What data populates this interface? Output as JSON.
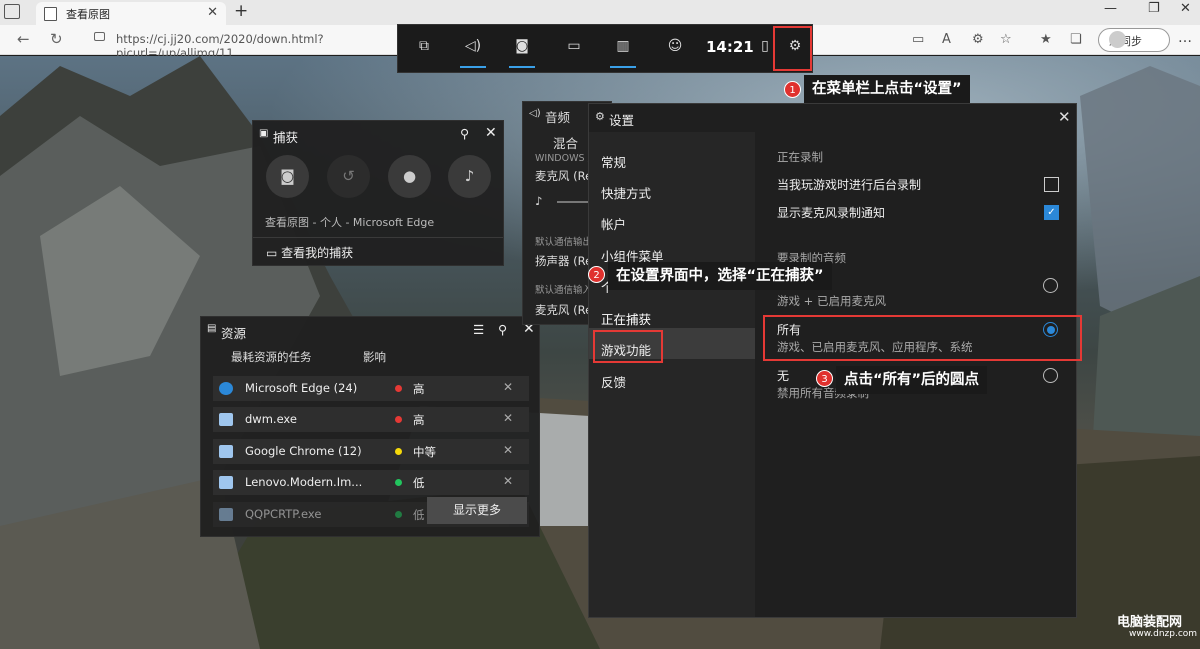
{
  "browser": {
    "tab_title": "查看原图",
    "url": "https://cj.jj20.com/2020/down.html?picurl=/up/allimg/11",
    "sync_label": "未同步"
  },
  "gamebar": {
    "time": "14:21"
  },
  "callouts": {
    "one": {
      "num": "1",
      "text": "在菜单栏上点击“设置”"
    },
    "two": {
      "num": "2",
      "text": "在设置界面中，选择“正在捕获”"
    },
    "three": {
      "num": "3",
      "text": "点击“所有”后的圆点"
    }
  },
  "capture": {
    "title": "捕获",
    "source": "查看原图 - 个人 - Microsoft Edge",
    "view_link": "查看我的捕获"
  },
  "resources": {
    "title": "资源",
    "col_task": "最耗资源的任务",
    "col_impact": "影响",
    "rows": [
      {
        "name": "Microsoft Edge (24)",
        "level": "高",
        "color": "#e53935"
      },
      {
        "name": "dwm.exe",
        "level": "高",
        "color": "#e53935"
      },
      {
        "name": "Google Chrome (12)",
        "level": "中等",
        "color": "#f5d90a"
      },
      {
        "name": "Lenovo.Modern.Im...",
        "level": "低",
        "color": "#22c55e"
      },
      {
        "name": "QQPCRTP.exe",
        "level": "低",
        "color": "#22c55e"
      }
    ],
    "show_more": "显示更多"
  },
  "audio": {
    "title": "音频",
    "tab_mix": "混合",
    "windows_label": "WINDOWS 默",
    "mic1": "麦克风 (Re",
    "default_out_label": "默认通信输出",
    "speaker": "扬声器 (Re",
    "default_in_label": "默认通信输入",
    "mic2": "麦克风 (Re"
  },
  "settings": {
    "title": "设置",
    "nav": [
      "常规",
      "快捷方式",
      "帐户",
      "小组件菜单",
      "个",
      "正在捕获",
      "游戏功能",
      "反馈"
    ],
    "selected": "正在捕获",
    "section_recording": "正在录制",
    "bg_record": "当我玩游戏时进行后台录制",
    "mic_notify": "显示麦克风录制通知",
    "section_audio": "要录制的音频",
    "opt_game_sub": "游戏 + 已启用麦克风",
    "opt_all": "所有",
    "opt_all_sub": "游戏、已启用麦克风、应用程序、系统",
    "opt_none": "无",
    "opt_none_sub": "禁用所有音频录制"
  },
  "watermark": {
    "name": "电脑装配网",
    "url": "www.dnzp.com"
  }
}
